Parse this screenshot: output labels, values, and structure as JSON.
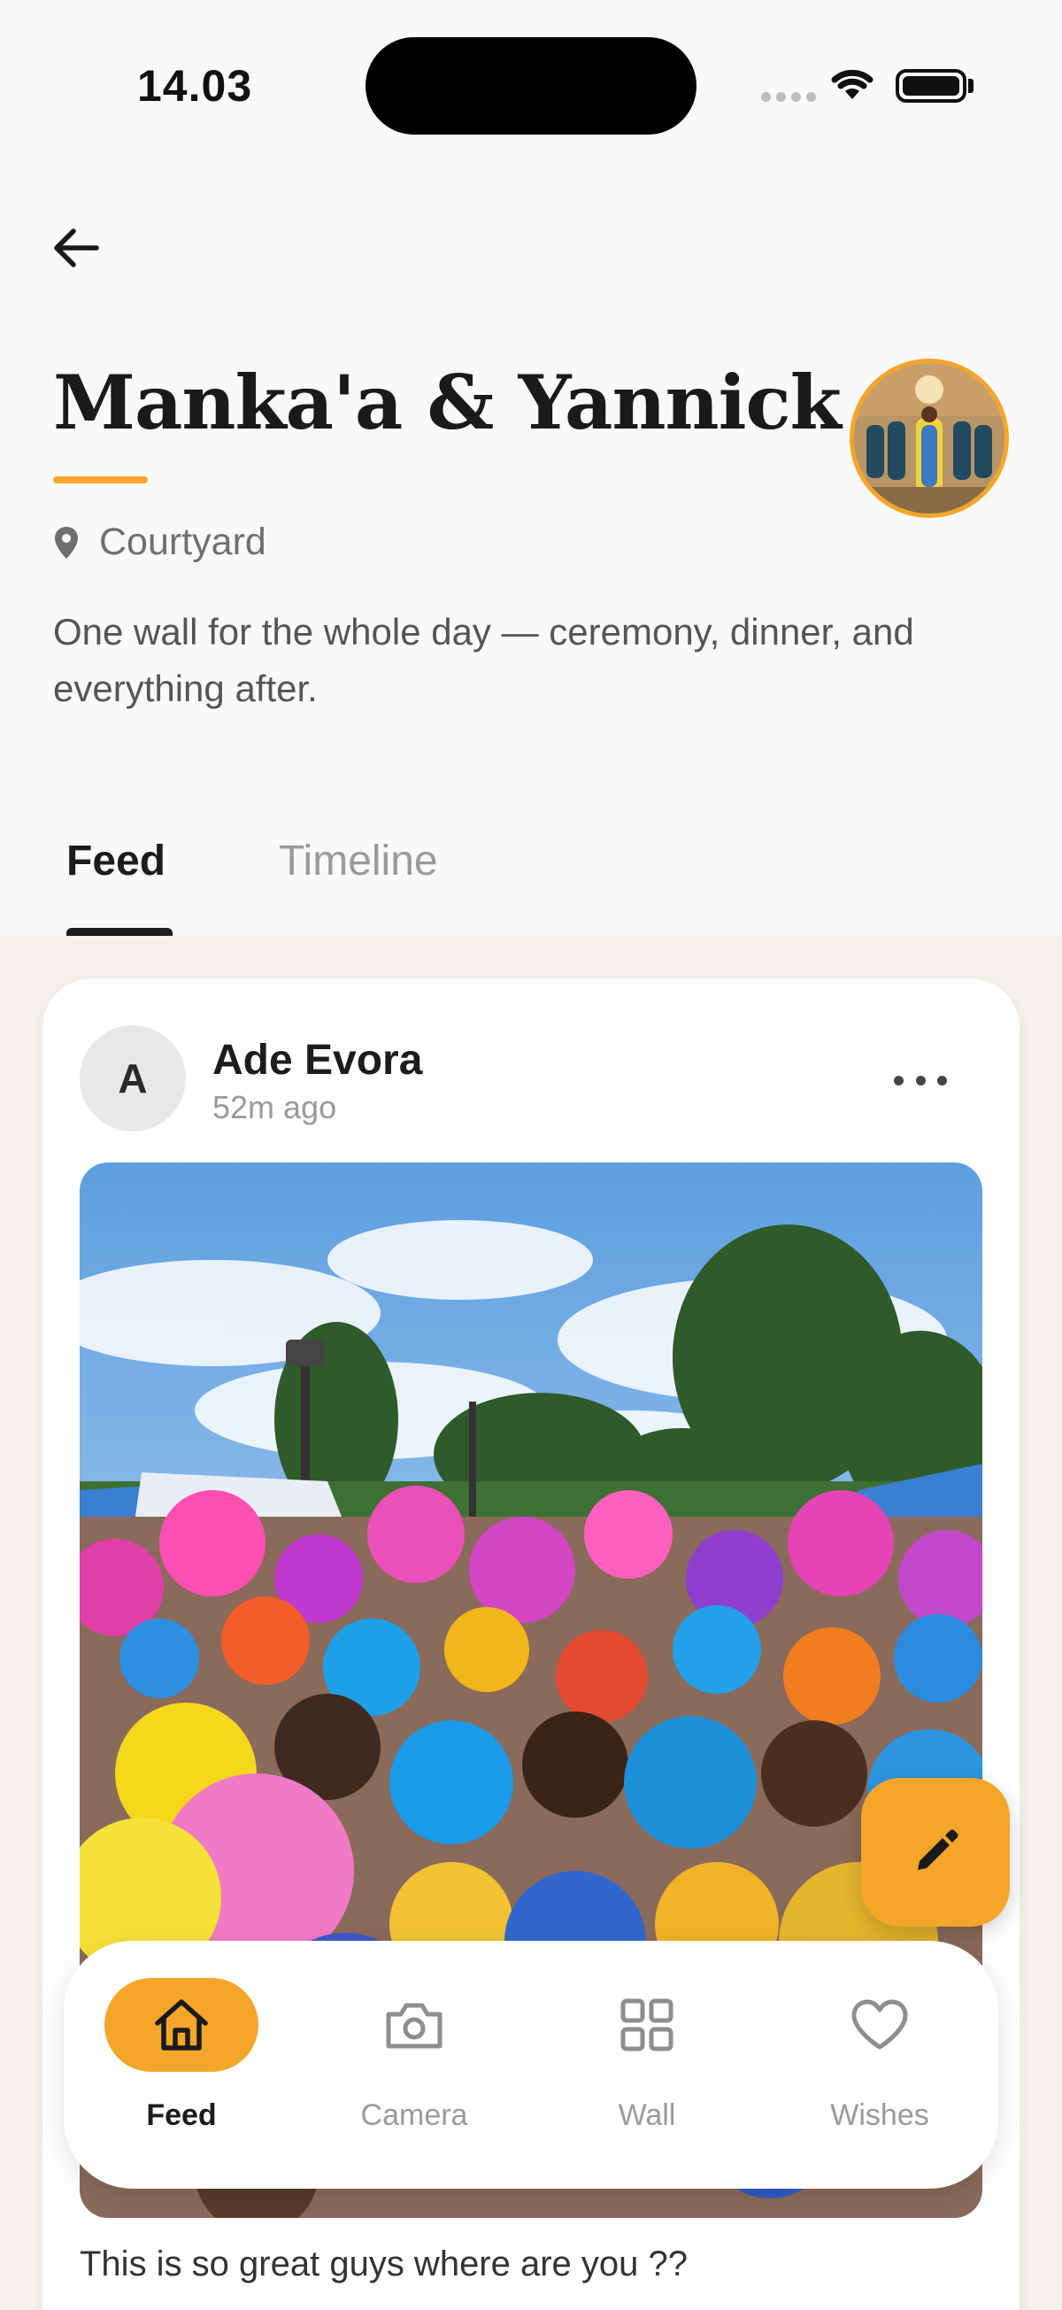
{
  "status_bar": {
    "time": "14.03"
  },
  "event": {
    "title": "Manka'a & Yannick",
    "location": "Courtyard",
    "description": "One wall for the whole day — ceremony, dinner, and everything after."
  },
  "tabs": [
    {
      "label": "Feed",
      "active": true
    },
    {
      "label": "Timeline",
      "active": false
    }
  ],
  "post": {
    "avatar_initial": "A",
    "author": "Ade Evora",
    "time": "52m ago",
    "caption": "This is so great guys where are you ??"
  },
  "bottom_nav": [
    {
      "label": "Feed",
      "icon": "home-icon",
      "active": true
    },
    {
      "label": "Camera",
      "icon": "camera-icon",
      "active": false
    },
    {
      "label": "Wall",
      "icon": "grid-icon",
      "active": false
    },
    {
      "label": "Wishes",
      "icon": "heart-icon",
      "active": false
    }
  ],
  "colors": {
    "accent": "#f4a62a",
    "feed_background": "#f5f1ec",
    "text_dark": "#1c1c1c",
    "text_muted": "#9a9a9a"
  }
}
